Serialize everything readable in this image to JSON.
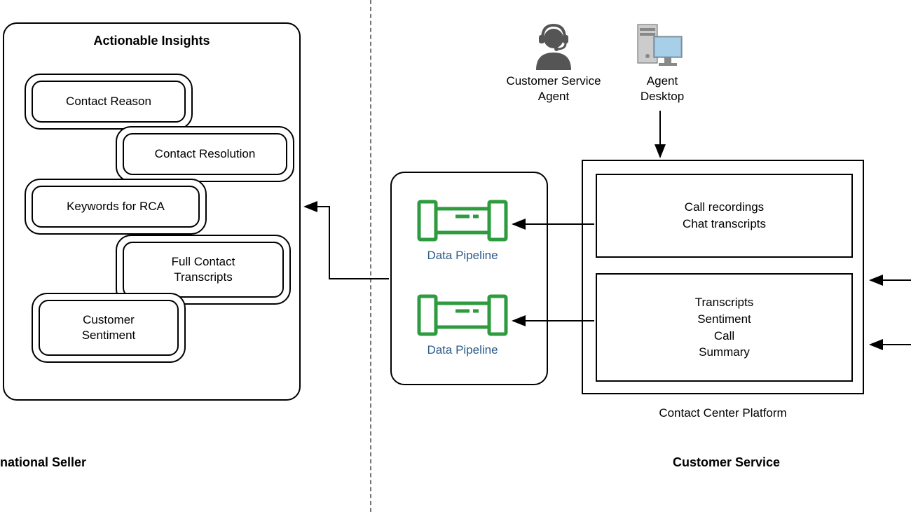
{
  "left": {
    "title": "Actionable Insights",
    "items": [
      "Contact Reason",
      "Contact Resolution",
      "Keywords for RCA",
      "Full Contact\nTranscripts",
      "Customer\nSentiment"
    ],
    "sectionLabel": "national Seller"
  },
  "middle": {
    "pipelineLabel1": "Data Pipeline",
    "pipelineLabel2": "Data Pipeline"
  },
  "right": {
    "agentLabel": "Customer Service\nAgent",
    "desktopLabel": "Agent\nDesktop",
    "box1": "Call recordings\nChat transcripts",
    "box2": "Transcripts\nSentiment\nCall\nSummary",
    "ccLabel": "Contact Center Platform",
    "sectionLabel": "Customer Service"
  }
}
